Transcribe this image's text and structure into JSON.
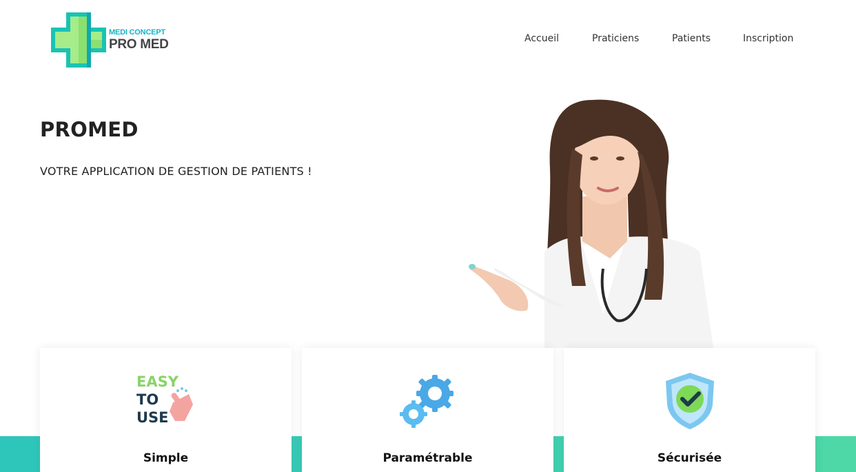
{
  "header": {
    "logo": {
      "line1": "MEDI CONCEPT",
      "line2": "PRO MED",
      "icon": "medical-cross-icon"
    },
    "nav": [
      {
        "label": "Accueil"
      },
      {
        "label": "Praticiens"
      },
      {
        "label": "Patients"
      },
      {
        "label": "Inscription"
      }
    ]
  },
  "hero": {
    "title": "PROMED",
    "subtitle": "VOTRE APPLICATION DE GESTION DE PATIENTS !",
    "image": "doctor-pointing-photo"
  },
  "features": [
    {
      "label": "Simple",
      "icon": "easy-to-use-icon",
      "icon_text": [
        "EASY",
        "TO",
        "USE"
      ]
    },
    {
      "label": "Paramétrable",
      "icon": "gears-icon"
    },
    {
      "label": "Sécurisée",
      "icon": "shield-check-icon"
    }
  ],
  "colors": {
    "accent_teal": "#2ec6bb",
    "accent_green": "#4fd8a7",
    "logo_cyan": "#14b3c7",
    "text": "#222222"
  }
}
